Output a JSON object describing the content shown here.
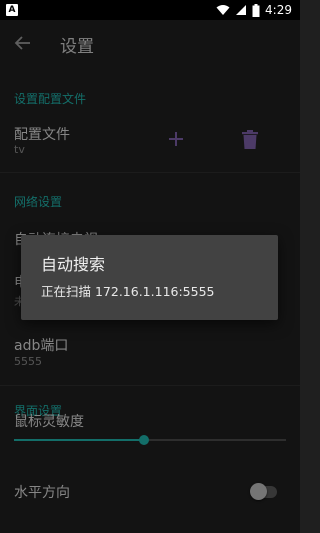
{
  "status_bar": {
    "notification_letter": "A",
    "time": "4:29"
  },
  "app_bar": {
    "title": "设置"
  },
  "sections": {
    "profile": {
      "header": "设置配置文件",
      "item_title": "配置文件",
      "item_value": "tv"
    },
    "network": {
      "header": "网络设置",
      "auto_connect_partial": "自动连接电视",
      "tv_ip_partial_title": "电",
      "tv_ip_partial_value": "未",
      "adb_port_title": "adb端口",
      "adb_port_value": "5555"
    },
    "interface": {
      "header": "界面设置",
      "mouse_sensitivity_title": "鼠标灵敏度",
      "mouse_sensitivity_level": 0.46,
      "horizontal_title": "水平方向",
      "horizontal_enabled": false
    }
  },
  "dialog": {
    "title": "自动搜索",
    "message": "正在扫描 172.16.1.116:5555"
  },
  "colors": {
    "accent": "#20b2aa",
    "icon_purple": "#7b5ea7",
    "background": "#1f1f1f",
    "dialog": "#424242"
  },
  "icons": [
    "back-arrow",
    "plus",
    "trash",
    "wifi",
    "cellular",
    "battery"
  ]
}
